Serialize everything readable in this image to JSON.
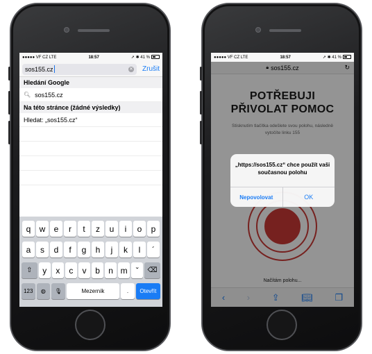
{
  "left_phone": {
    "status": {
      "carrier": "●●●●● VF CZ  LTE",
      "time": "18:57",
      "battery": "41 %"
    },
    "search": {
      "value": "sos155.cz",
      "cancel_label": "Zrušit"
    },
    "sections": [
      {
        "header": "Hledání Google",
        "items": [
          "sos155.cz"
        ]
      },
      {
        "header": "Na této stránce (žádné výsledky)",
        "items": [
          "Hledat: „sos155.cz“"
        ]
      }
    ],
    "keyboard": {
      "row1": [
        "q",
        "w",
        "e",
        "r",
        "t",
        "z",
        "u",
        "i",
        "o",
        "p"
      ],
      "row2": [
        "a",
        "s",
        "d",
        "f",
        "g",
        "h",
        "j",
        "k",
        "l",
        "´"
      ],
      "row3": [
        "y",
        "x",
        "c",
        "v",
        "b",
        "n",
        "m",
        "ˇ"
      ],
      "numbers_label": "123",
      "space_label": "Mezerník",
      "dot_label": ".",
      "go_label": "Otevřít"
    }
  },
  "right_phone": {
    "status": {
      "carrier": "●●●●● VF CZ  LTE",
      "time": "18:57",
      "battery": "41 %"
    },
    "url": "sos155.cz",
    "title_line1": "POTŘEBUJI",
    "title_line2": "PŘIVOLAT POMOC",
    "description": "Stisknutím tlačítka odešlete svou polohu, následně vytočíte linku 155",
    "loading_text": "Načítám polohu...",
    "alert": {
      "message": "„https://sos155.cz“ chce použít vaši současnou polohu",
      "deny_label": "Nepovolovat",
      "ok_label": "OK"
    },
    "accent_color": "#cc3a36"
  }
}
